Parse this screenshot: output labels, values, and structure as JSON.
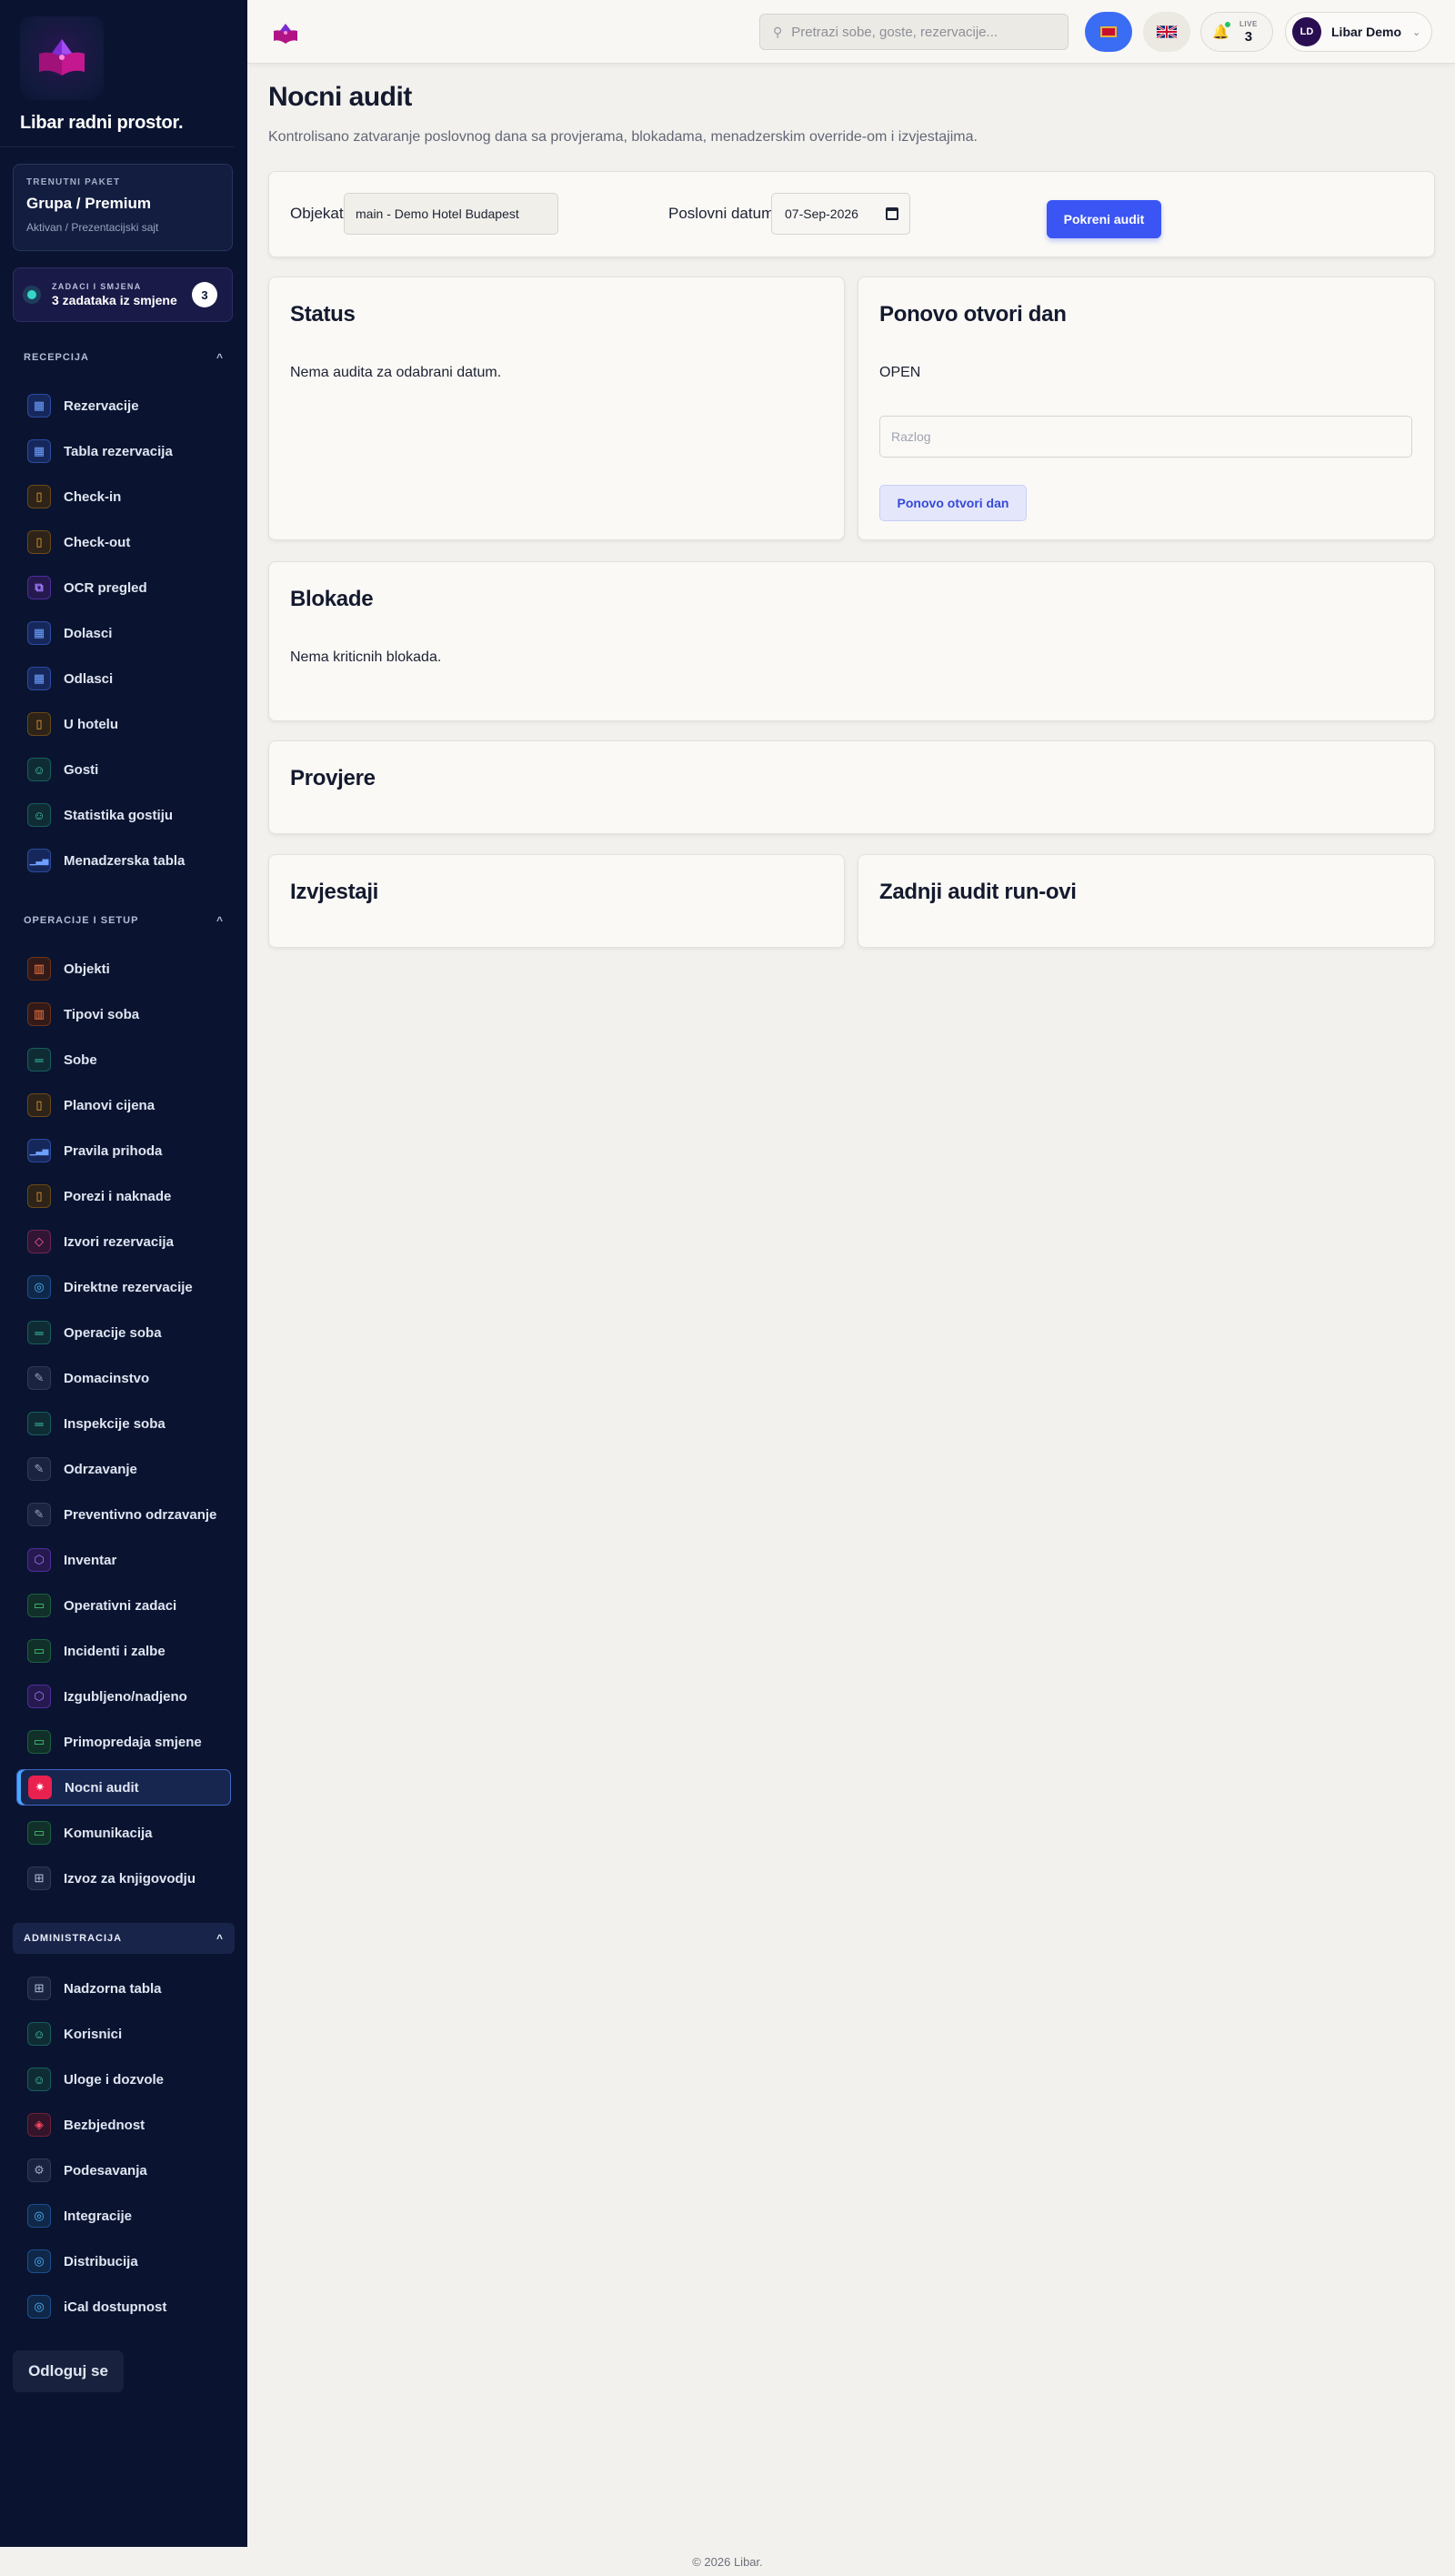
{
  "app": {
    "brand_name": "Libar radni prostor.",
    "footer": "© 2026 Libar."
  },
  "plan": {
    "kicker": "TRENUTNI PAKET",
    "name": "Grupa / Premium",
    "sub": "Aktivan / Prezentacijski sajt"
  },
  "tasks": {
    "kicker": "ZADACI I SMJENA",
    "text": "3 zadataka iz smjene",
    "count": "3"
  },
  "sections": {
    "recepcija": {
      "label": "RECEPCIJA",
      "chevron": "^"
    },
    "operacije": {
      "label": "OPERACIJE I SETUP",
      "chevron": "^"
    },
    "administracija": {
      "label": "ADMINISTRACIJA",
      "chevron": "^"
    }
  },
  "nav": {
    "recepcija": [
      {
        "label": "Rezervacije",
        "icon": "calendar-icon"
      },
      {
        "label": "Tabla rezervacija",
        "icon": "calendar-icon"
      },
      {
        "label": "Check-in",
        "icon": "door-icon"
      },
      {
        "label": "Check-out",
        "icon": "door-icon"
      },
      {
        "label": "OCR pregled",
        "icon": "scan-icon"
      },
      {
        "label": "Dolasci",
        "icon": "calendar-icon"
      },
      {
        "label": "Odlasci",
        "icon": "calendar-icon"
      },
      {
        "label": "U hotelu",
        "icon": "door-icon"
      },
      {
        "label": "Gosti",
        "icon": "user-icon"
      },
      {
        "label": "Statistika gostiju",
        "icon": "user-icon"
      },
      {
        "label": "Menadzerska tabla",
        "icon": "bar-chart-icon"
      }
    ],
    "operacije": [
      {
        "label": "Objekti",
        "icon": "building-icon"
      },
      {
        "label": "Tipovi soba",
        "icon": "building-icon"
      },
      {
        "label": "Sobe",
        "icon": "bed-icon"
      },
      {
        "label": "Planovi cijena",
        "icon": "door-icon"
      },
      {
        "label": "Pravila prihoda",
        "icon": "bar-chart-icon"
      },
      {
        "label": "Porezi i naknade",
        "icon": "door-icon"
      },
      {
        "label": "Izvori rezervacija",
        "icon": "tag-icon"
      },
      {
        "label": "Direktne rezervacije",
        "icon": "globe-icon"
      },
      {
        "label": "Operacije soba",
        "icon": "bed-icon"
      },
      {
        "label": "Domacinstvo",
        "icon": "wrench-icon"
      },
      {
        "label": "Inspekcije soba",
        "icon": "bed-icon"
      },
      {
        "label": "Odrzavanje",
        "icon": "wrench-icon"
      },
      {
        "label": "Preventivno odrzavanje",
        "icon": "wrench-icon"
      },
      {
        "label": "Inventar",
        "icon": "box-icon"
      },
      {
        "label": "Operativni zadaci",
        "icon": "chat-icon"
      },
      {
        "label": "Incidenti i zalbe",
        "icon": "chat-icon"
      },
      {
        "label": "Izgubljeno/nadjeno",
        "icon": "box-icon"
      },
      {
        "label": "Primopredaja smjene",
        "icon": "chat-icon"
      },
      {
        "label": "Nocni audit",
        "icon": "audit-icon",
        "active": true
      },
      {
        "label": "Komunikacija",
        "icon": "chat-icon"
      },
      {
        "label": "Izvoz za knjigovodju",
        "icon": "grid-icon"
      }
    ],
    "administracija": [
      {
        "label": "Nadzorna tabla",
        "icon": "grid-icon"
      },
      {
        "label": "Korisnici",
        "icon": "user-icon"
      },
      {
        "label": "Uloge i dozvole",
        "icon": "user-icon"
      },
      {
        "label": "Bezbjednost",
        "icon": "shield-icon"
      },
      {
        "label": "Podesavanja",
        "icon": "gear-icon"
      },
      {
        "label": "Integracije",
        "icon": "globe-icon"
      },
      {
        "label": "Distribucija",
        "icon": "globe-icon"
      },
      {
        "label": "iCal dostupnost",
        "icon": "globe-icon"
      }
    ]
  },
  "logout_label": "Odloguj se",
  "topbar": {
    "search_placeholder": "Pretrazi sobe, goste, rezervacije...",
    "live_label": "LIVE",
    "live_count": "3",
    "user_initials": "LD",
    "user_name": "Libar Demo"
  },
  "page": {
    "title": "Nocni audit",
    "subtitle": "Kontrolisano zatvaranje poslovnog dana sa provjerama, blokadama, menadzerskim override-om i izvjestajima."
  },
  "filters": {
    "object_label": "Objekat",
    "object_value": "main - Demo Hotel Budapest",
    "date_label": "Poslovni datum",
    "date_value": "07-Sep-2026",
    "run_button": "Pokreni audit"
  },
  "status_card": {
    "title": "Status",
    "message": "Nema audita za odabrani datum."
  },
  "reopen_card": {
    "title": "Ponovo otvori dan",
    "state": "OPEN",
    "reason_placeholder": "Razlog",
    "button": "Ponovo otvori dan"
  },
  "blocks_card": {
    "title": "Blokade",
    "message": "Nema kriticnih blokada."
  },
  "checks_card": {
    "title": "Provjere"
  },
  "reports_card": {
    "title": "Izvjestaji"
  },
  "runs_card": {
    "title": "Zadnji audit run-ovi"
  },
  "colors": {
    "sidebar_bg": "#0a1430",
    "accent": "#3a55f4",
    "active_icon": "#e8214f",
    "page_bg": "#f3f1ee"
  }
}
